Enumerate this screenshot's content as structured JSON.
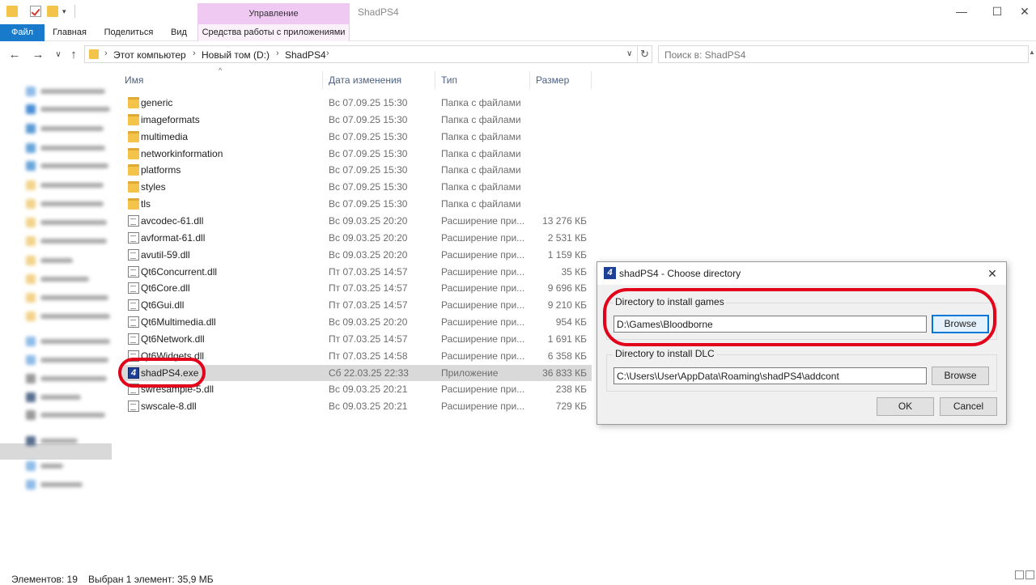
{
  "window": {
    "title": "ShadPS4",
    "context_tab": "Управление",
    "minimize": "—",
    "maximize": "☐",
    "close": "✕"
  },
  "ribbon": {
    "tabs": [
      "Файл",
      "Главная",
      "Поделиться",
      "Вид",
      "Средства работы с приложениями"
    ]
  },
  "address": {
    "breadcrumbs": [
      "Этот компьютер",
      "Новый том (D:)",
      "ShadPS4"
    ],
    "search_placeholder": "Поиск в: ShadPS4"
  },
  "columns": {
    "name": "Имя",
    "date": "Дата изменения",
    "type": "Тип",
    "size": "Размер"
  },
  "files": [
    {
      "name": "generic",
      "date": "Вс 07.09.25 15:30",
      "type": "Папка с файлами",
      "size": "",
      "icon": "folder-icon"
    },
    {
      "name": "imageformats",
      "date": "Вс 07.09.25 15:30",
      "type": "Папка с файлами",
      "size": "",
      "icon": "folder-icon"
    },
    {
      "name": "multimedia",
      "date": "Вс 07.09.25 15:30",
      "type": "Папка с файлами",
      "size": "",
      "icon": "folder-icon"
    },
    {
      "name": "networkinformation",
      "date": "Вс 07.09.25 15:30",
      "type": "Папка с файлами",
      "size": "",
      "icon": "folder-icon"
    },
    {
      "name": "platforms",
      "date": "Вс 07.09.25 15:30",
      "type": "Папка с файлами",
      "size": "",
      "icon": "folder-icon"
    },
    {
      "name": "styles",
      "date": "Вс 07.09.25 15:30",
      "type": "Папка с файлами",
      "size": "",
      "icon": "folder-icon"
    },
    {
      "name": "tls",
      "date": "Вс 07.09.25 15:30",
      "type": "Папка с файлами",
      "size": "",
      "icon": "folder-icon"
    },
    {
      "name": "avcodec-61.dll",
      "date": "Вс 09.03.25 20:20",
      "type": "Расширение при...",
      "size": "13 276 КБ",
      "icon": "dll-file-icon"
    },
    {
      "name": "avformat-61.dll",
      "date": "Вс 09.03.25 20:20",
      "type": "Расширение при...",
      "size": "2 531 КБ",
      "icon": "dll-file-icon"
    },
    {
      "name": "avutil-59.dll",
      "date": "Вс 09.03.25 20:20",
      "type": "Расширение при...",
      "size": "1 159 КБ",
      "icon": "dll-file-icon"
    },
    {
      "name": "Qt6Concurrent.dll",
      "date": "Пт 07.03.25 14:57",
      "type": "Расширение при...",
      "size": "35 КБ",
      "icon": "dll-file-icon"
    },
    {
      "name": "Qt6Core.dll",
      "date": "Пт 07.03.25 14:57",
      "type": "Расширение при...",
      "size": "9 696 КБ",
      "icon": "dll-file-icon"
    },
    {
      "name": "Qt6Gui.dll",
      "date": "Пт 07.03.25 14:57",
      "type": "Расширение при...",
      "size": "9 210 КБ",
      "icon": "dll-file-icon"
    },
    {
      "name": "Qt6Multimedia.dll",
      "date": "Вс 09.03.25 20:20",
      "type": "Расширение при...",
      "size": "954 КБ",
      "icon": "dll-file-icon"
    },
    {
      "name": "Qt6Network.dll",
      "date": "Пт 07.03.25 14:57",
      "type": "Расширение при...",
      "size": "1 691 КБ",
      "icon": "dll-file-icon"
    },
    {
      "name": "Qt6Widgets.dll",
      "date": "Пт 07.03.25 14:58",
      "type": "Расширение при...",
      "size": "6 358 КБ",
      "icon": "dll-file-icon"
    },
    {
      "name": "shadPS4.exe",
      "date": "Сб 22.03.25 22:33",
      "type": "Приложение",
      "size": "36 833 КБ",
      "icon": "shadps4-app-icon",
      "selected": true
    },
    {
      "name": "swresample-5.dll",
      "date": "Вс 09.03.25 20:21",
      "type": "Расширение при...",
      "size": "238 КБ",
      "icon": "dll-file-icon"
    },
    {
      "name": "swscale-8.dll",
      "date": "Вс 09.03.25 20:21",
      "type": "Расширение при...",
      "size": "729 КБ",
      "icon": "dll-file-icon"
    }
  ],
  "status": {
    "item_count": "Элементов: 19",
    "selection": "Выбран 1 элемент: 35,9 МБ"
  },
  "dialog": {
    "icon_glyph": "4",
    "title": "shadPS4 - Choose directory",
    "close": "✕",
    "games_label": "Directory to install games",
    "games_path": "D:\\Games\\Bloodborne",
    "games_browse": "Browse",
    "dlc_label": "Directory to install DLC",
    "dlc_path": "C:\\Users\\User\\AppData\\Roaming\\shadPS4\\addcont",
    "dlc_browse": "Browse",
    "ok": "OK",
    "cancel": "Cancel"
  },
  "colors": {
    "accent": "#1979ca",
    "highlight_ring": "#e3001b",
    "context_tab": "#f0c9f3",
    "selected_row": "#d9d9d9"
  }
}
